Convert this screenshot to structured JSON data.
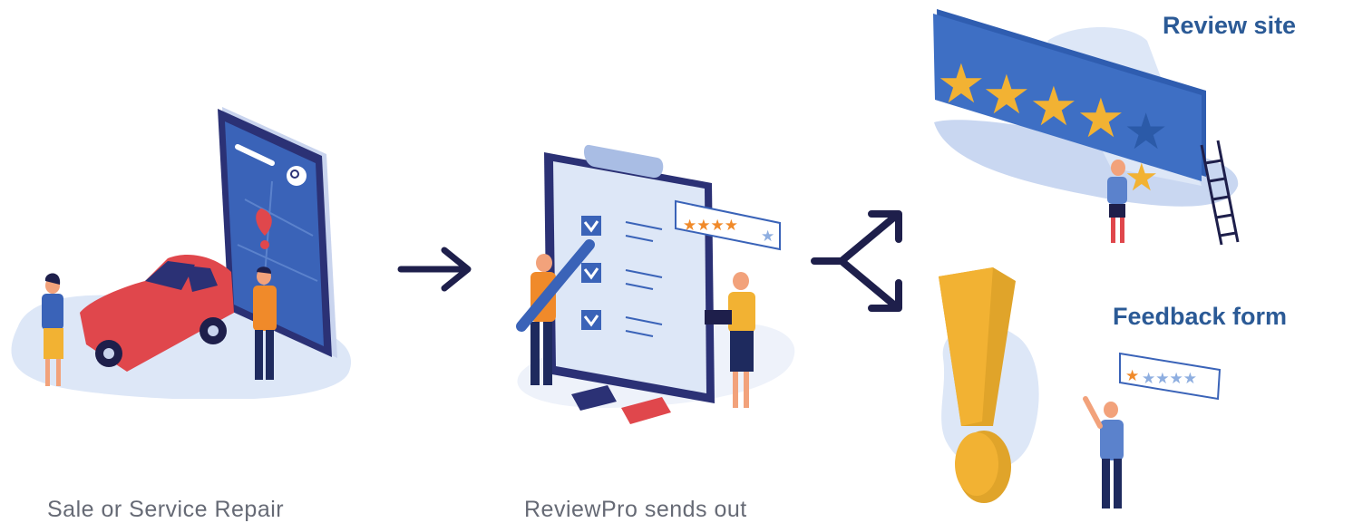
{
  "steps": [
    {
      "caption": "Sale or Service Repair"
    },
    {
      "caption": "ReviewPro sends out"
    }
  ],
  "outcomes": [
    {
      "label": "Review site"
    },
    {
      "label": "Feedback form"
    }
  ],
  "colors": {
    "navy": "#1e1f4b",
    "blue": "#3a6cc0",
    "light_blue": "#dde7f7",
    "red": "#e0474c",
    "gold": "#f2b233",
    "orange": "#f08a2a",
    "label": "#2b5a96"
  },
  "icons": [
    "car-icon",
    "phone-map-icon",
    "arrow-right-icon",
    "clipboard-checklist-icon",
    "branch-arrow-icon",
    "star-sign-icon",
    "exclamation-icon",
    "star-rating-icon"
  ]
}
